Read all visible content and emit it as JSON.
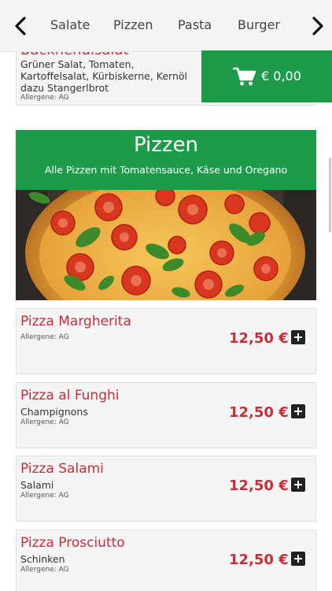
{
  "nav": {
    "categories": [
      "Salate",
      "Pizzen",
      "Pasta",
      "Burger"
    ]
  },
  "previous_item": {
    "title": "Backhendlsalat",
    "description": "Grüner Salat, Tomaten, Kartoffelsalat, Kürbiskerne, Kernöl dazu Stangerlbrot",
    "allergens": "Allergene: AG"
  },
  "cart": {
    "amount": "€ 0,00"
  },
  "section": {
    "title": "Pizzen",
    "subtitle": "Alle Pizzen mit Tomatensauce, Käse und Oregano"
  },
  "products": [
    {
      "name": "Pizza Margherita",
      "description": "",
      "allergens": "Allergene: AG",
      "price": "12,50 €"
    },
    {
      "name": "Pizza al Funghi",
      "description": "Champignons",
      "allergens": "Allergene: AG",
      "price": "12,50 €"
    },
    {
      "name": "Pizza Salami",
      "description": "Salami",
      "allergens": "Allergene: AG",
      "price": "12,50 €"
    },
    {
      "name": "Pizza Prosciutto",
      "description": "Schinken",
      "allergens": "Allergene: AG",
      "price": "12,50 €"
    }
  ],
  "icons": {
    "prev": "chevron-left-icon",
    "next": "chevron-right-icon",
    "cart": "cart-icon",
    "add": "plus-icon"
  },
  "colors": {
    "brand_green": "#1d9a4a",
    "price_red": "#c62e3a"
  }
}
